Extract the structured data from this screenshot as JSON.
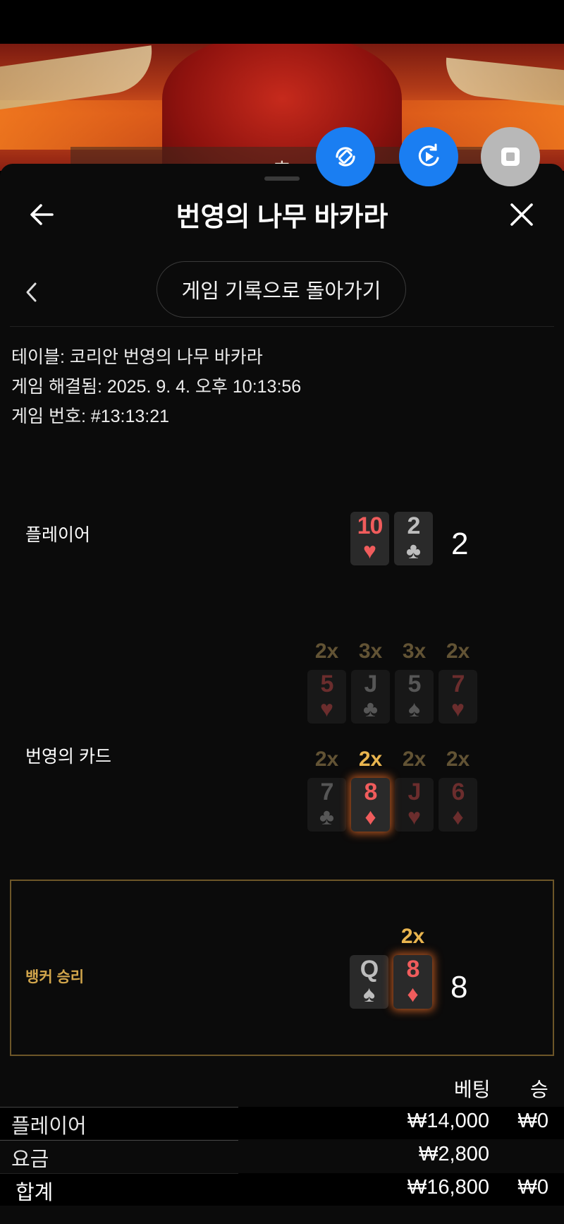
{
  "video": {
    "label": "호"
  },
  "controls": {
    "rotate_icon": "rotate-device-icon",
    "replay_icon": "replay-icon",
    "stop_icon": "stop-icon"
  },
  "header": {
    "title": "번영의 나무 바카라"
  },
  "history_button": "게임 기록으로 돌아가기",
  "info": {
    "table": "테이블: 코리안 번영의 나무 바카라",
    "resolved": "게임 해결됨: 2025. 9. 4. 오후 10:13:56",
    "game_no": "게임 번호: #13:13:21"
  },
  "player": {
    "label": "플레이어",
    "cards": [
      {
        "rank": "10",
        "suit": "♥"
      },
      {
        "rank": "2",
        "suit": "♣"
      }
    ],
    "score": "2"
  },
  "fortune": {
    "label": "번영의 카드",
    "row1": [
      {
        "mult": "2x",
        "rank": "5",
        "suit": "♥"
      },
      {
        "mult": "3x",
        "rank": "J",
        "suit": "♣"
      },
      {
        "mult": "3x",
        "rank": "5",
        "suit": "♠"
      },
      {
        "mult": "2x",
        "rank": "7",
        "suit": "♥"
      }
    ],
    "row2": [
      {
        "mult": "2x",
        "rank": "7",
        "suit": "♣"
      },
      {
        "mult": "2x",
        "rank": "8",
        "suit": "♦"
      },
      {
        "mult": "2x",
        "rank": "J",
        "suit": "♥"
      },
      {
        "mult": "2x",
        "rank": "6",
        "suit": "♦"
      }
    ]
  },
  "banker": {
    "label": "뱅커 승리",
    "mult": "2x",
    "cards": [
      {
        "rank": "Q",
        "suit": "♠"
      },
      {
        "rank": "8",
        "suit": "♦"
      }
    ],
    "score": "8"
  },
  "table": {
    "col_bet": "베팅",
    "col_win": "승",
    "rows": [
      {
        "name": "플레이어",
        "bet": "₩14,000",
        "win": "₩0"
      },
      {
        "name": "요금",
        "bet": "₩2,800",
        "win": ""
      },
      {
        "name": "합계",
        "bet": "₩16,800",
        "win": "₩0"
      }
    ]
  },
  "colors": {
    "accent_blue": "#1a7ef2",
    "gold": "#d2a64c",
    "card_red": "#f05c5c"
  }
}
